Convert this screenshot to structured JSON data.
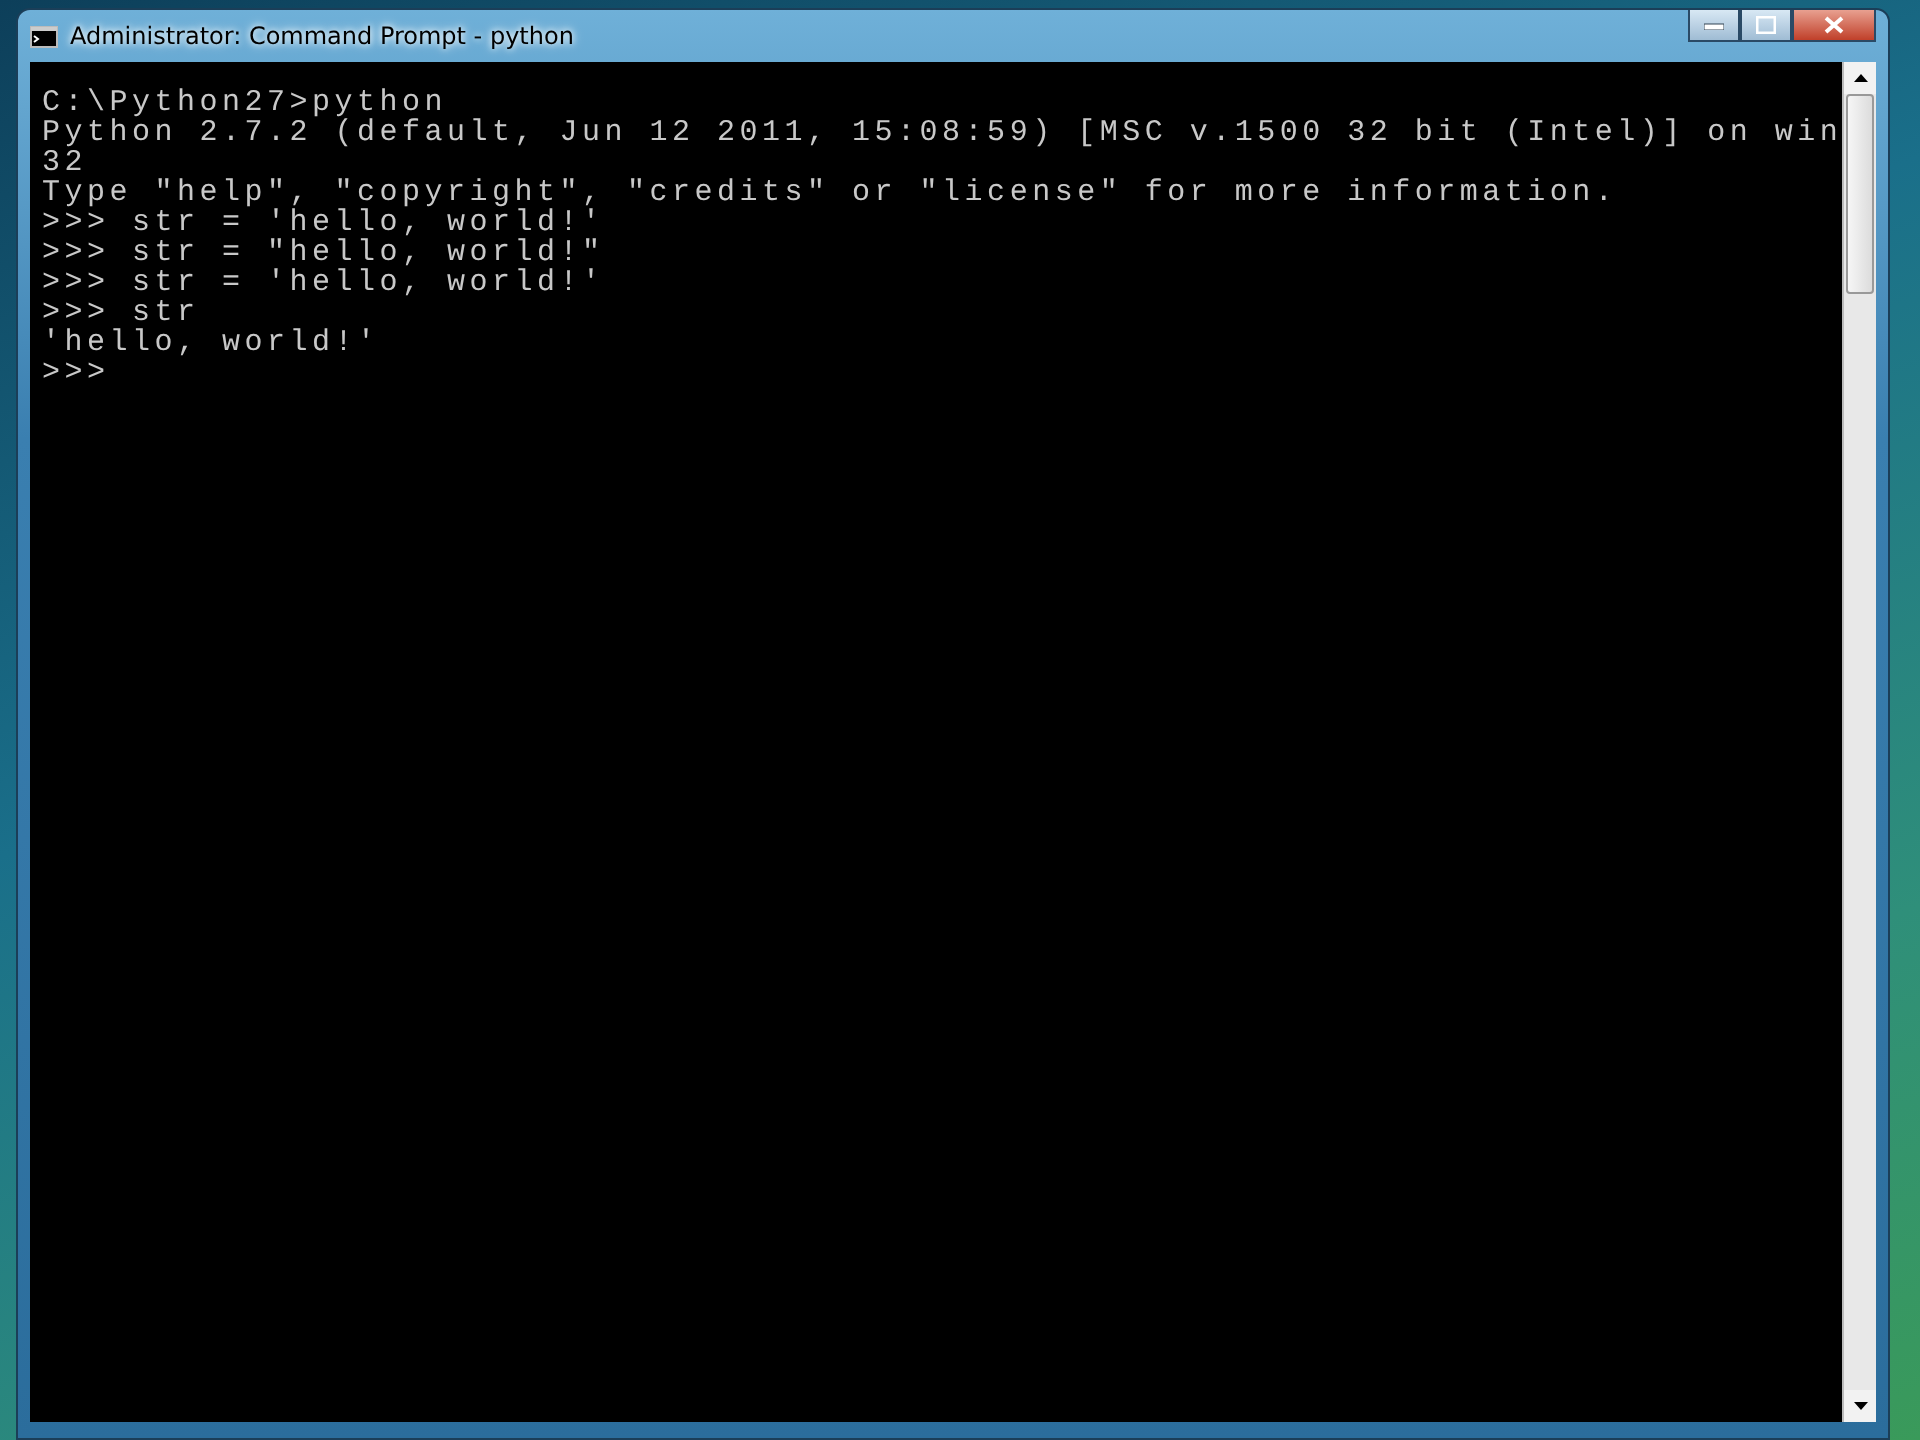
{
  "window": {
    "title": "Administrator: Command Prompt - python"
  },
  "console": {
    "lines": [
      "C:\\Python27>python",
      "Python 2.7.2 (default, Jun 12 2011, 15:08:59) [MSC v.1500 32 bit (Intel)] on win",
      "32",
      "Type \"help\", \"copyright\", \"credits\" or \"license\" for more information.",
      ">>> str = 'hello, world!'",
      ">>> str = \"hello, world!\"",
      ">>> str = 'hello, world!'",
      ">>> str",
      "'hello, world!'",
      ">>>"
    ]
  }
}
